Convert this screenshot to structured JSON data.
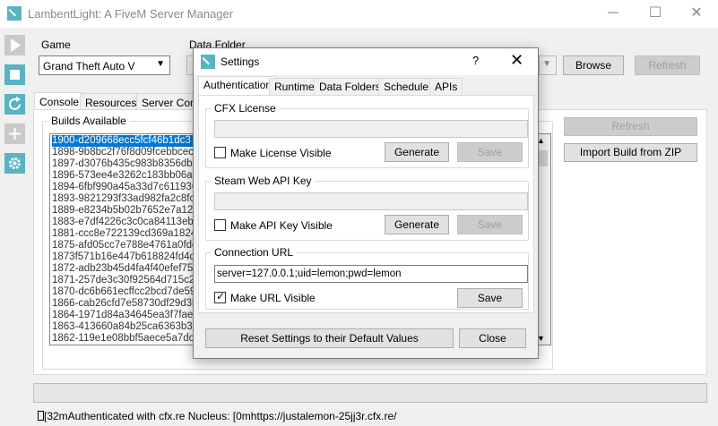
{
  "app": {
    "title": "LambentLight: A FiveM Server Manager",
    "window_controls": {
      "minimize": "─",
      "maximize": "☐",
      "close": "✕"
    }
  },
  "sidebar": {
    "icons": [
      "play-icon",
      "stop-icon",
      "restart-icon",
      "add-icon",
      "gear-icon"
    ],
    "accent": "#5ab3c4"
  },
  "header": {
    "game_label": "Game",
    "game_value": "Grand Theft Auto V",
    "data_folder_label": "Data Folder",
    "browse_label": "Browse",
    "refresh_label": "Refresh"
  },
  "main_tabs": [
    "Console",
    "Resources",
    "Server Confi"
  ],
  "builds": {
    "title": "Builds Available",
    "refresh_label": "Refresh",
    "import_label": "Import Build from ZIP",
    "items": [
      "1900-d209668ecc5fcf46b1dc3",
      "1898-9b8bc2f76f8d09fcebbcecd3",
      "1897-d3076b435c983b8356dbc2",
      "1896-573ee4e3262c183bb06aa0",
      "1894-6fbf990a45a33d7c6119368",
      "1893-9821293f33ad982fa2c8fc3a",
      "1889-e8234b5b02b7652e7a1258",
      "1883-e7df4226c3c0ca84113ebee",
      "1881-ccc8e722139cd369a18245",
      "1875-afd05cc7e788e4761a0fded",
      "1873f571b16e447b618824fd4dc",
      "1872-adb23b45d4fa4f40efef7594",
      "1871-257de3c30f92564d715c2ea",
      "1870-dc6b661ecffcc2bcd7de599",
      "1866-cab26cfd7e58730df29d3b8",
      "1864-1971d84a34645ea3f7faeba",
      "1863-413660a84b25ca6363b3f62",
      "1862-119e1e08bbf5aece5a7dc9a"
    ]
  },
  "console_line": "[32mAuthenticated with cfx.re Nucleus: [0mhttps://justalemon-25jj3r.cfx.re/",
  "dialog": {
    "title": "Settings",
    "help": "?",
    "close": "✕",
    "tabs": [
      "Authentication",
      "Runtime",
      "Data Folders",
      "Schedule",
      "APIs"
    ],
    "cfx": {
      "title": "CFX License",
      "value": "",
      "checkbox_label": "Make License Visible",
      "checked": false,
      "generate_label": "Generate",
      "save_label": "Save"
    },
    "steam": {
      "title": "Steam Web API Key",
      "value": "",
      "checkbox_label": "Make API Key Visible",
      "checked": false,
      "generate_label": "Generate",
      "save_label": "Save"
    },
    "connection": {
      "title": "Connection URL",
      "value": "server=127.0.0.1;uid=lemon;pwd=lemon",
      "checkbox_label": "Make URL Visible",
      "checked": true,
      "save_label": "Save"
    },
    "reset_label": "Reset Settings to their Default Values",
    "close_label": "Close"
  }
}
